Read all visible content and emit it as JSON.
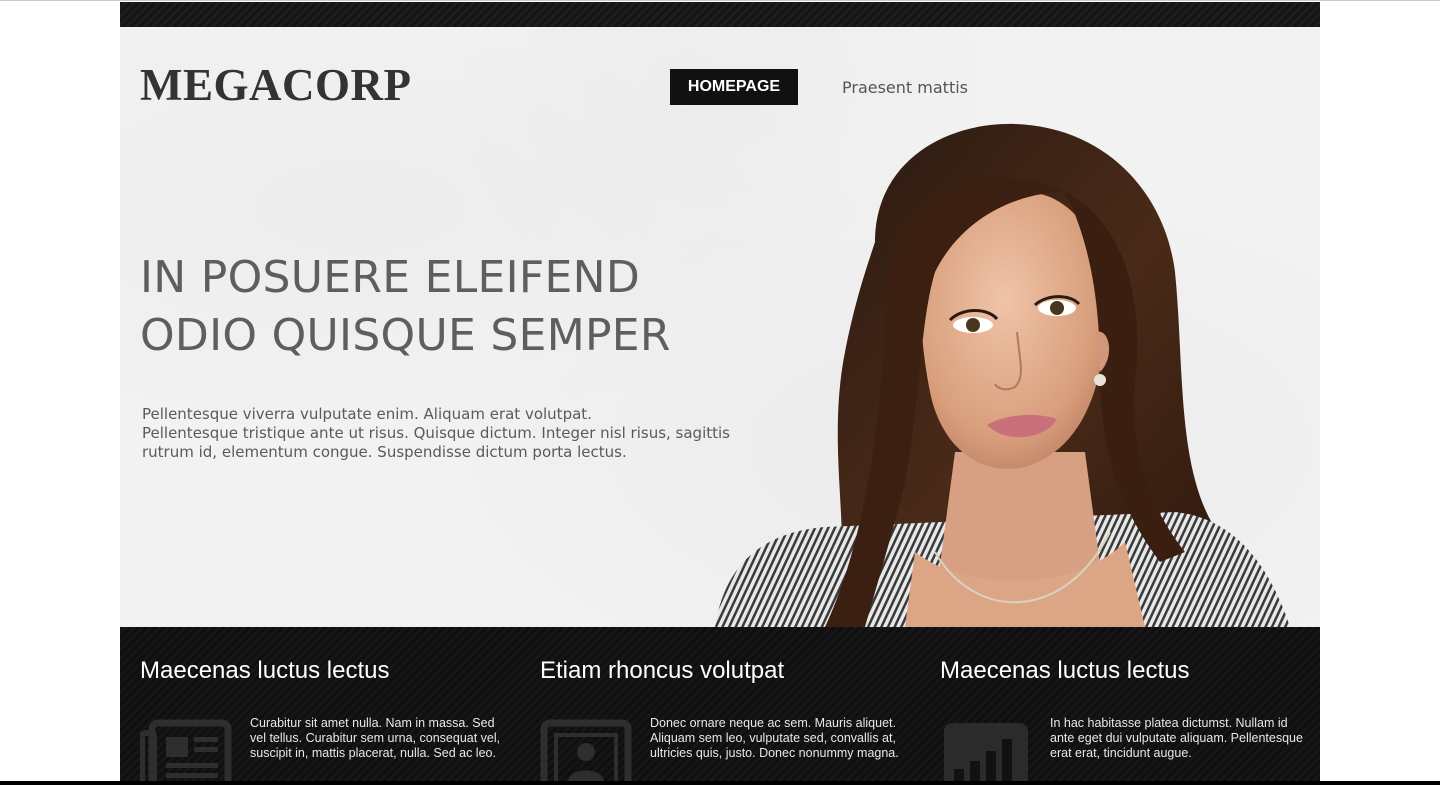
{
  "brand": {
    "logo": "MEGACORP"
  },
  "nav": {
    "items": [
      {
        "label": "HOMEPAGE",
        "active": true
      },
      {
        "label": "Praesent mattis",
        "active": false
      }
    ]
  },
  "hero": {
    "headline_line1": "IN POSUERE ELEIFEND",
    "headline_line2": "ODIO QUISQUE SEMPER",
    "paragraph_line1": "Pellentesque viverra vulputate enim. Aliquam erat volutpat.",
    "paragraph_line2": "Pellentesque tristique ante ut risus. Quisque dictum. Integer nisl risus, sagittis",
    "paragraph_line3": "rutrum id, elementum congue. Suspendisse dictum porta lectus."
  },
  "features": [
    {
      "title": "Maecenas luctus lectus",
      "text": "Curabitur sit amet nulla. Nam in massa. Sed vel tellus. Curabitur sem urna, consequat vel, suscipit in, mattis placerat, nulla. Sed ac leo.",
      "icon": "newspaper-icon"
    },
    {
      "title": "Etiam rhoncus volutpat",
      "text": "Donec ornare neque ac sem. Mauris aliquet. Aliquam sem leo, vulputate sed, convallis at, ultricies quis, justo. Donec nonummy magna.",
      "icon": "id-card-icon"
    },
    {
      "title": "Maecenas luctus lectus",
      "text": "In hac habitasse platea dictumst. Nullam id ante eget dui vulputate aliquam. Pellentesque erat erat, tincidunt augue.",
      "icon": "bar-chart-icon"
    }
  ],
  "colors": {
    "hero_background": "#f2f2f2",
    "dark_band": "#111111",
    "active_nav": "#111111",
    "headline_text": "#5e5e5e"
  }
}
